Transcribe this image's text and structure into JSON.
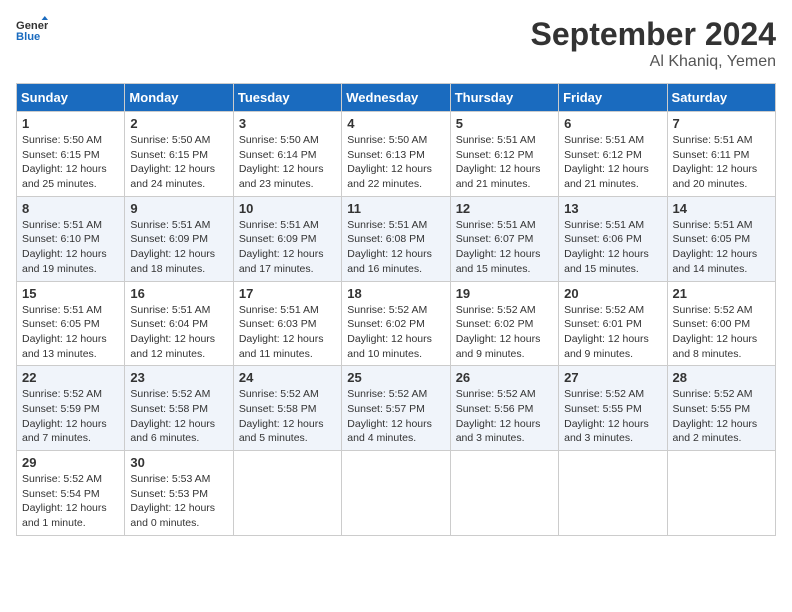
{
  "header": {
    "logo_general": "General",
    "logo_blue": "Blue",
    "month_title": "September 2024",
    "location": "Al Khaniq, Yemen"
  },
  "days_of_week": [
    "Sunday",
    "Monday",
    "Tuesday",
    "Wednesday",
    "Thursday",
    "Friday",
    "Saturday"
  ],
  "weeks": [
    [
      {
        "day": "1",
        "sunrise": "Sunrise: 5:50 AM",
        "sunset": "Sunset: 6:15 PM",
        "daylight": "Daylight: 12 hours and 25 minutes."
      },
      {
        "day": "2",
        "sunrise": "Sunrise: 5:50 AM",
        "sunset": "Sunset: 6:15 PM",
        "daylight": "Daylight: 12 hours and 24 minutes."
      },
      {
        "day": "3",
        "sunrise": "Sunrise: 5:50 AM",
        "sunset": "Sunset: 6:14 PM",
        "daylight": "Daylight: 12 hours and 23 minutes."
      },
      {
        "day": "4",
        "sunrise": "Sunrise: 5:50 AM",
        "sunset": "Sunset: 6:13 PM",
        "daylight": "Daylight: 12 hours and 22 minutes."
      },
      {
        "day": "5",
        "sunrise": "Sunrise: 5:51 AM",
        "sunset": "Sunset: 6:12 PM",
        "daylight": "Daylight: 12 hours and 21 minutes."
      },
      {
        "day": "6",
        "sunrise": "Sunrise: 5:51 AM",
        "sunset": "Sunset: 6:12 PM",
        "daylight": "Daylight: 12 hours and 21 minutes."
      },
      {
        "day": "7",
        "sunrise": "Sunrise: 5:51 AM",
        "sunset": "Sunset: 6:11 PM",
        "daylight": "Daylight: 12 hours and 20 minutes."
      }
    ],
    [
      {
        "day": "8",
        "sunrise": "Sunrise: 5:51 AM",
        "sunset": "Sunset: 6:10 PM",
        "daylight": "Daylight: 12 hours and 19 minutes."
      },
      {
        "day": "9",
        "sunrise": "Sunrise: 5:51 AM",
        "sunset": "Sunset: 6:09 PM",
        "daylight": "Daylight: 12 hours and 18 minutes."
      },
      {
        "day": "10",
        "sunrise": "Sunrise: 5:51 AM",
        "sunset": "Sunset: 6:09 PM",
        "daylight": "Daylight: 12 hours and 17 minutes."
      },
      {
        "day": "11",
        "sunrise": "Sunrise: 5:51 AM",
        "sunset": "Sunset: 6:08 PM",
        "daylight": "Daylight: 12 hours and 16 minutes."
      },
      {
        "day": "12",
        "sunrise": "Sunrise: 5:51 AM",
        "sunset": "Sunset: 6:07 PM",
        "daylight": "Daylight: 12 hours and 15 minutes."
      },
      {
        "day": "13",
        "sunrise": "Sunrise: 5:51 AM",
        "sunset": "Sunset: 6:06 PM",
        "daylight": "Daylight: 12 hours and 15 minutes."
      },
      {
        "day": "14",
        "sunrise": "Sunrise: 5:51 AM",
        "sunset": "Sunset: 6:05 PM",
        "daylight": "Daylight: 12 hours and 14 minutes."
      }
    ],
    [
      {
        "day": "15",
        "sunrise": "Sunrise: 5:51 AM",
        "sunset": "Sunset: 6:05 PM",
        "daylight": "Daylight: 12 hours and 13 minutes."
      },
      {
        "day": "16",
        "sunrise": "Sunrise: 5:51 AM",
        "sunset": "Sunset: 6:04 PM",
        "daylight": "Daylight: 12 hours and 12 minutes."
      },
      {
        "day": "17",
        "sunrise": "Sunrise: 5:51 AM",
        "sunset": "Sunset: 6:03 PM",
        "daylight": "Daylight: 12 hours and 11 minutes."
      },
      {
        "day": "18",
        "sunrise": "Sunrise: 5:52 AM",
        "sunset": "Sunset: 6:02 PM",
        "daylight": "Daylight: 12 hours and 10 minutes."
      },
      {
        "day": "19",
        "sunrise": "Sunrise: 5:52 AM",
        "sunset": "Sunset: 6:02 PM",
        "daylight": "Daylight: 12 hours and 9 minutes."
      },
      {
        "day": "20",
        "sunrise": "Sunrise: 5:52 AM",
        "sunset": "Sunset: 6:01 PM",
        "daylight": "Daylight: 12 hours and 9 minutes."
      },
      {
        "day": "21",
        "sunrise": "Sunrise: 5:52 AM",
        "sunset": "Sunset: 6:00 PM",
        "daylight": "Daylight: 12 hours and 8 minutes."
      }
    ],
    [
      {
        "day": "22",
        "sunrise": "Sunrise: 5:52 AM",
        "sunset": "Sunset: 5:59 PM",
        "daylight": "Daylight: 12 hours and 7 minutes."
      },
      {
        "day": "23",
        "sunrise": "Sunrise: 5:52 AM",
        "sunset": "Sunset: 5:58 PM",
        "daylight": "Daylight: 12 hours and 6 minutes."
      },
      {
        "day": "24",
        "sunrise": "Sunrise: 5:52 AM",
        "sunset": "Sunset: 5:58 PM",
        "daylight": "Daylight: 12 hours and 5 minutes."
      },
      {
        "day": "25",
        "sunrise": "Sunrise: 5:52 AM",
        "sunset": "Sunset: 5:57 PM",
        "daylight": "Daylight: 12 hours and 4 minutes."
      },
      {
        "day": "26",
        "sunrise": "Sunrise: 5:52 AM",
        "sunset": "Sunset: 5:56 PM",
        "daylight": "Daylight: 12 hours and 3 minutes."
      },
      {
        "day": "27",
        "sunrise": "Sunrise: 5:52 AM",
        "sunset": "Sunset: 5:55 PM",
        "daylight": "Daylight: 12 hours and 3 minutes."
      },
      {
        "day": "28",
        "sunrise": "Sunrise: 5:52 AM",
        "sunset": "Sunset: 5:55 PM",
        "daylight": "Daylight: 12 hours and 2 minutes."
      }
    ],
    [
      {
        "day": "29",
        "sunrise": "Sunrise: 5:52 AM",
        "sunset": "Sunset: 5:54 PM",
        "daylight": "Daylight: 12 hours and 1 minute."
      },
      {
        "day": "30",
        "sunrise": "Sunrise: 5:53 AM",
        "sunset": "Sunset: 5:53 PM",
        "daylight": "Daylight: 12 hours and 0 minutes."
      },
      null,
      null,
      null,
      null,
      null
    ]
  ]
}
